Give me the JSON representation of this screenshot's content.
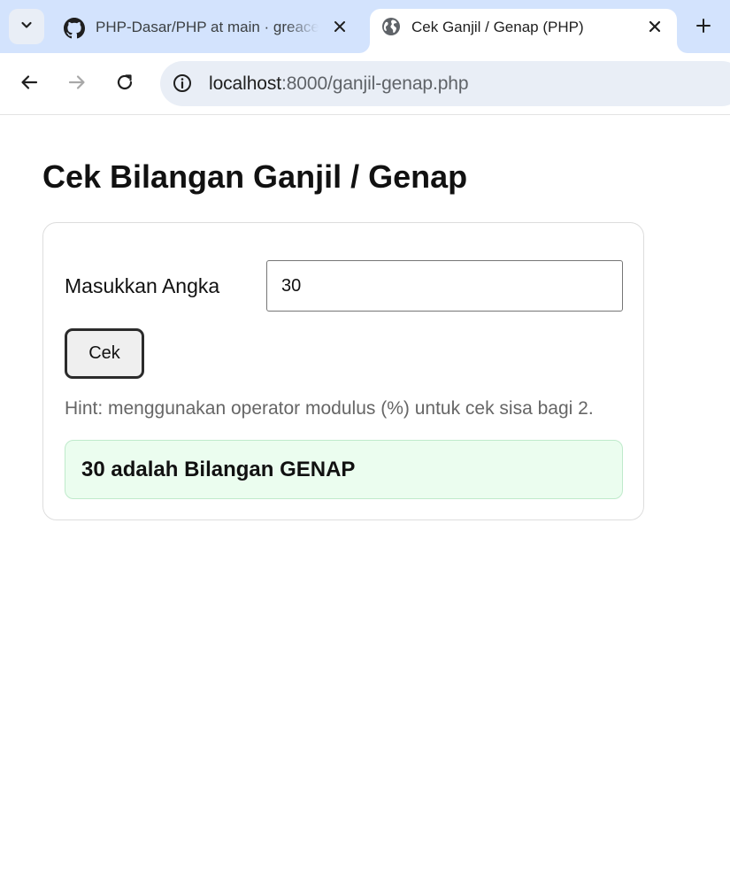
{
  "colors": {
    "tabstrip_bg": "#d3e3fd",
    "omnibox_bg": "#e9eef6",
    "result_bg": "#ebfdef",
    "result_border": "#bfeacb",
    "hint_text": "#666666"
  },
  "browser": {
    "tabs": [
      {
        "title": "PHP-Dasar/PHP at main · greace",
        "icon": "github-icon",
        "active": false
      },
      {
        "title": "Cek Ganjil / Genap (PHP)",
        "icon": "globe-icon",
        "active": true
      }
    ],
    "address": {
      "host": "localhost",
      "path": ":8000/ganjil-genap.php"
    }
  },
  "page": {
    "title": "Cek Bilangan Ganjil / Genap",
    "form": {
      "label": "Masukkan Angka",
      "input_value": "30",
      "button_label": "Cek",
      "hint": "Hint: menggunakan operator modulus (%) untuk cek sisa bagi 2."
    },
    "result": "30 adalah Bilangan GENAP"
  }
}
